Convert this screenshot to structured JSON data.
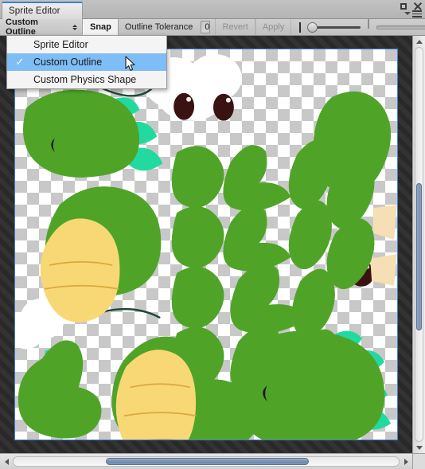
{
  "window": {
    "tab_label": "Sprite Editor",
    "maximize_icon": "maximize-icon",
    "close_icon": "close-icon",
    "options_icon": "options-menu-icon"
  },
  "toolbar": {
    "mode_popup_label": "Custom Outline",
    "mode_popup_icon": "updown-arrows-icon",
    "snap_label": "Snap",
    "tolerance_label": "Outline Tolerance",
    "tolerance_value": "0",
    "revert_label": "Revert",
    "apply_label": "Apply",
    "rgb_icon": "rgb-channels-icon",
    "alpha_icon": "alpha-checker-icon",
    "zoom_slider_value": 6,
    "alpha_slider_value": 0
  },
  "menu": {
    "items": [
      {
        "label": "Sprite Editor",
        "checked": false
      },
      {
        "label": "Custom Outline",
        "checked": true
      },
      {
        "label": "Custom Physics Shape",
        "checked": false
      }
    ],
    "check_glyph": "✓"
  },
  "canvas": {
    "name": "sprite-sheet-canvas",
    "selection_border_color": "#3f7fd8",
    "background_color": "#2b2b2b",
    "checker_light": "#ffffff",
    "checker_dark": "#c8c8c8"
  },
  "palette": {
    "green": "#4FA428",
    "green_dark": "#3f8c20",
    "teal": "#22D9A0",
    "yellow": "#F8D874",
    "yellow_line": "#d9a93f",
    "eye_brown": "#3B1212",
    "white": "#ffffff",
    "outline_dark": "#1d4a34"
  },
  "scrollbars": {
    "vertical_thumb_color": "#7d93b4",
    "horizontal_thumb_color": "#7188ab",
    "up_arrow_icon": "triangle-up-icon",
    "down_arrow_icon": "triangle-down-icon",
    "left_arrow_icon": "triangle-left-icon",
    "right_arrow_icon": "triangle-right-icon"
  },
  "cursor": {
    "icon": "mouse-pointer-icon"
  }
}
